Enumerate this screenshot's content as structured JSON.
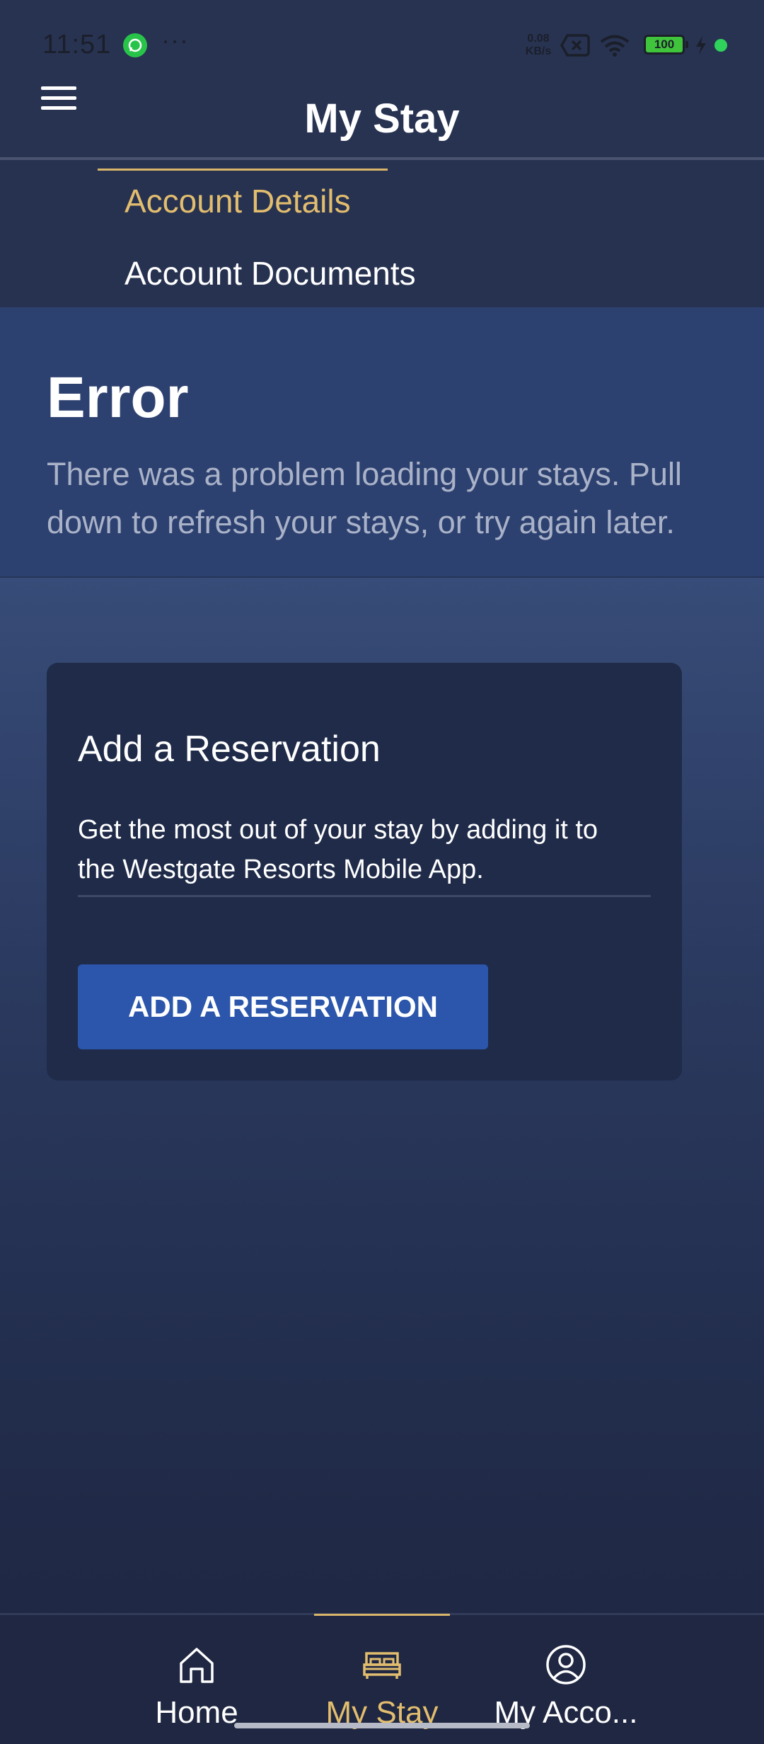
{
  "status_bar": {
    "time": "11:51",
    "more_indicator": "···",
    "network_speed_value": "0.08",
    "network_speed_unit": "KB/s",
    "battery_level": "100",
    "icons": [
      "whatsapp-icon",
      "data-off-icon",
      "wifi-icon",
      "battery-icon",
      "charging-icon",
      "notification-dot"
    ]
  },
  "app_bar": {
    "title": "My Stay",
    "menu_icon": "hamburger-menu-icon"
  },
  "submenu": {
    "items": [
      {
        "label": "Account Details",
        "active": true
      },
      {
        "label": "Account Documents",
        "active": false
      }
    ],
    "accent_color": "#e2bd6e"
  },
  "error": {
    "title": "Error",
    "message": "There was a problem loading your stays. Pull down to refresh your stays, or try again later."
  },
  "reservation_card": {
    "title": "Add a Reservation",
    "description": "Get the most out of your stay by adding it to the Westgate Resorts Mobile App.",
    "button_label": "ADD A RESERVATION",
    "button_color": "#2b56ac"
  },
  "bottom_nav": {
    "items": [
      {
        "label": "Home",
        "icon": "home-icon",
        "active": false
      },
      {
        "label": "My Stay",
        "icon": "bed-icon",
        "active": true
      },
      {
        "label": "My Acco...",
        "icon": "account-icon",
        "active": false
      }
    ]
  }
}
